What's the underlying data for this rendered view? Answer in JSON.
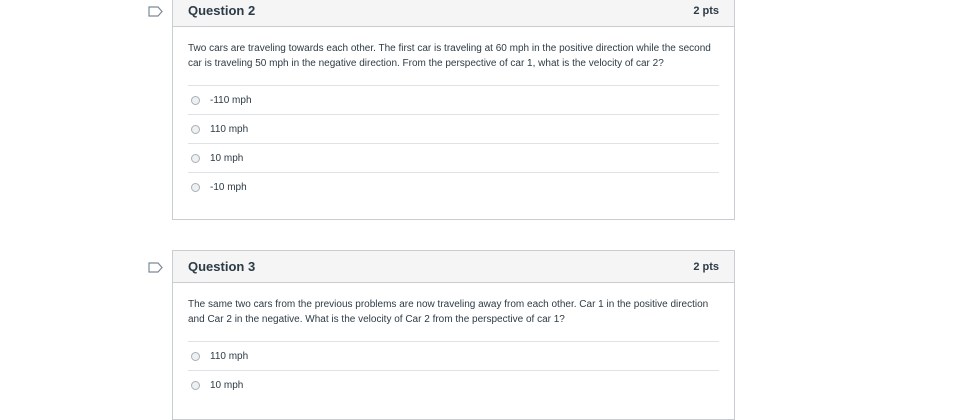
{
  "questions": [
    {
      "title": "Question 2",
      "points": "2 pts",
      "text": "Two cars are traveling towards each other. The first car is traveling at 60 mph in the positive direction while the second car is traveling 50 mph in the negative direction. From the perspective of car 1, what is the velocity of car 2?",
      "answers": [
        "-110 mph",
        "110 mph",
        "10 mph",
        "-10 mph"
      ]
    },
    {
      "title": "Question 3",
      "points": "2 pts",
      "text": "The same two cars from the previous problems are now traveling away from each other. Car 1 in the positive direction and Car 2 in the negative. What is the velocity of Car 2 from the perspective of car 1?",
      "answers": [
        "110 mph",
        "10 mph"
      ]
    }
  ],
  "colors": {
    "header_bg": "#f5f5f5",
    "border": "#c7cdd1",
    "text": "#2d3b45"
  }
}
